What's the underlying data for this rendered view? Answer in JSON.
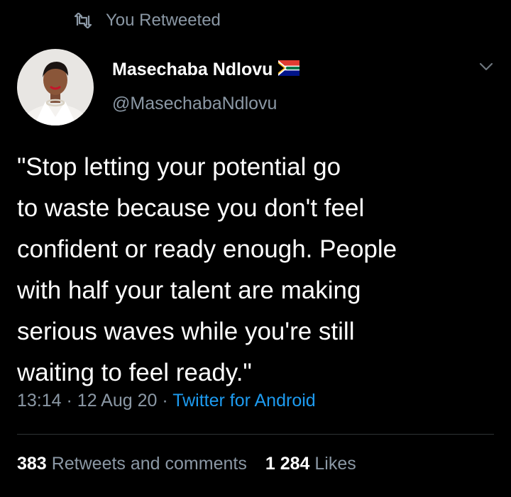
{
  "retweet_banner": {
    "icon": "retweet-icon",
    "label": "You Retweeted"
  },
  "author": {
    "display_name": "Masechaba Ndlovu",
    "handle": "@MasechabaNdlovu",
    "flag_icon": "south-africa-flag-icon"
  },
  "tweet": {
    "text": "\"Stop letting your potential go\nto waste because you don't feel\nconfident or ready enough. People\nwith half your talent are making\nserious waves while you're still\nwaiting to feel ready.\"",
    "time": "13:14",
    "separator": "·",
    "date": "12 Aug 20",
    "source": "Twitter for Android"
  },
  "stats": {
    "retweets_count": "383",
    "retweets_label": "Retweets and comments",
    "likes_count": "1 284",
    "likes_label": "Likes"
  },
  "colors": {
    "background": "#000000",
    "primary_text": "#ffffff",
    "secondary_text": "#8b98a5",
    "link": "#1d9bf0",
    "divider": "#2f3336"
  }
}
